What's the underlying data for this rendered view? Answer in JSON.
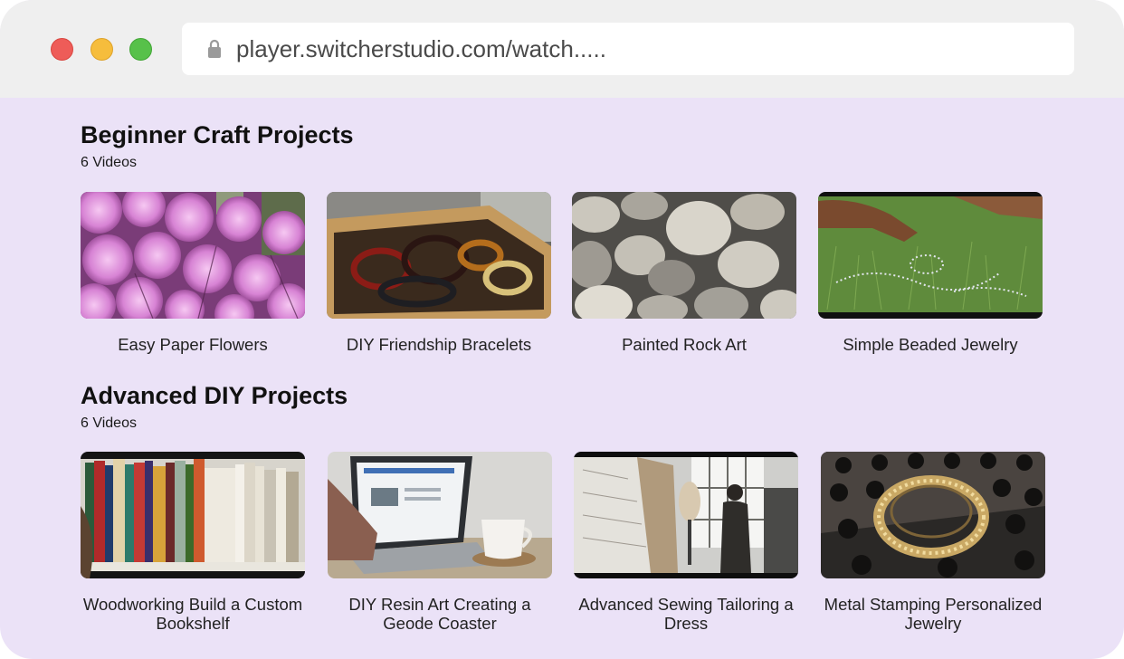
{
  "browser": {
    "url": "player.switcherstudio.com/watch.....",
    "icons": {
      "close": "red-close-dot",
      "minimize": "yellow-minimize-dot",
      "maximize": "green-maximize-dot",
      "lock": "lock-icon"
    }
  },
  "colors": {
    "page_background": "#ebe2f7",
    "chrome_background": "#efefef"
  },
  "sections": [
    {
      "title": "Beginner Craft Projects",
      "count": "6 Videos",
      "videos": [
        {
          "title": "Easy Paper Flowers",
          "thumbnail": "pink-flowers"
        },
        {
          "title": "DIY Friendship Bracelets",
          "thumbnail": "beaded-bracelets-box"
        },
        {
          "title": "Painted Rock Art",
          "thumbnail": "river-stones"
        },
        {
          "title": "Simple Beaded Jewelry",
          "thumbnail": "beads-on-grass"
        }
      ]
    },
    {
      "title": "Advanced DIY Projects",
      "count": "6 Videos",
      "videos": [
        {
          "title": "Woodworking Build a Custom Bookshelf",
          "thumbnail": "bookshelf"
        },
        {
          "title": "DIY Resin Art Creating a Geode Coaster",
          "thumbnail": "laptop-and-mug"
        },
        {
          "title": "Advanced Sewing Tailoring a Dress",
          "thumbnail": "sewing-studio"
        },
        {
          "title": "Metal Stamping Personalized Jewelry",
          "thumbnail": "metal-ring"
        }
      ]
    }
  ]
}
